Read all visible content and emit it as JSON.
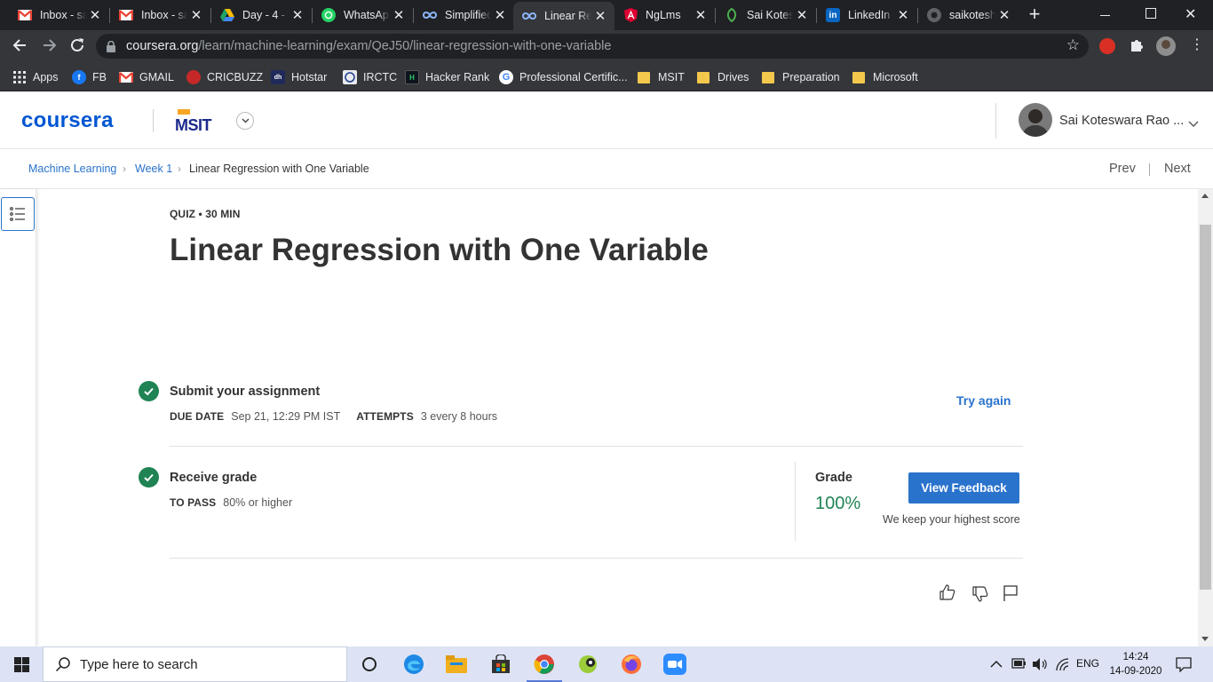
{
  "browser": {
    "tabs": [
      {
        "title": "Inbox - sa",
        "icon": "gmail-icon"
      },
      {
        "title": "Inbox - sa",
        "icon": "gmail-icon"
      },
      {
        "title": "Day - 4 -",
        "icon": "google-drive-icon"
      },
      {
        "title": "WhatsApp",
        "icon": "whatsapp-icon"
      },
      {
        "title": "Simplified",
        "icon": "coursera-infinity-icon"
      },
      {
        "title": "Linear Re",
        "icon": "coursera-infinity-icon",
        "active": true
      },
      {
        "title": "NgLms",
        "icon": "angular-icon"
      },
      {
        "title": "Sai Kotes",
        "icon": "leaf-icon"
      },
      {
        "title": "LinkedIn",
        "icon": "linkedin-icon"
      },
      {
        "title": "saikotesh",
        "icon": "github-icon"
      }
    ],
    "new_tab": "+",
    "url_host": "coursera.org",
    "url_path": "/learn/machine-learning/exam/QeJ50/linear-regression-with-one-variable",
    "bookmarks": [
      {
        "label": "Apps",
        "icon": "apps-grid-icon"
      },
      {
        "label": "FB",
        "icon": "facebook-icon"
      },
      {
        "label": "GMAIL",
        "icon": "gmail-icon"
      },
      {
        "label": "CRICBUZZ",
        "icon": "cricbuzz-icon"
      },
      {
        "label": "Hotstar",
        "icon": "hotstar-icon"
      },
      {
        "label": "IRCTC",
        "icon": "irctc-icon"
      },
      {
        "label": "Hacker Rank",
        "icon": "hackerrank-icon"
      },
      {
        "label": "Professional Certific...",
        "icon": "google-icon"
      },
      {
        "label": "MSIT",
        "icon": "folder-icon"
      },
      {
        "label": "Drives",
        "icon": "folder-icon"
      },
      {
        "label": "Preparation",
        "icon": "folder-icon"
      },
      {
        "label": "Microsoft",
        "icon": "folder-icon"
      }
    ]
  },
  "site": {
    "logo": "coursera",
    "partner_logo": "MSIT",
    "user_name": "Sai Koteswara Rao ...",
    "colors": {
      "brand": "#0056d2",
      "link": "#2a73cc",
      "success": "#1f8354",
      "button": "#2a73cc"
    }
  },
  "breadcrumb": {
    "items": [
      "Machine Learning",
      "Week 1",
      "Linear Regression with One Variable"
    ],
    "prev": "Prev",
    "next": "Next"
  },
  "quiz": {
    "meta": "QUIZ • 30 MIN",
    "title": "Linear Regression with One Variable",
    "submit": {
      "heading": "Submit your assignment",
      "due_label": "DUE DATE",
      "due_value": "Sep 21, 12:29 PM IST",
      "attempts_label": "ATTEMPTS",
      "attempts_value": "3 every 8 hours",
      "action": "Try again"
    },
    "grade": {
      "heading": "Receive grade",
      "pass_label": "TO PASS",
      "pass_value": "80% or higher",
      "grade_label": "Grade",
      "grade_value": "100%",
      "feedback_button": "View Feedback",
      "note": "We keep your highest score"
    }
  },
  "taskbar": {
    "search_placeholder": "Type here to search",
    "language": "ENG",
    "time": "14:24",
    "date": "14-09-2020"
  }
}
